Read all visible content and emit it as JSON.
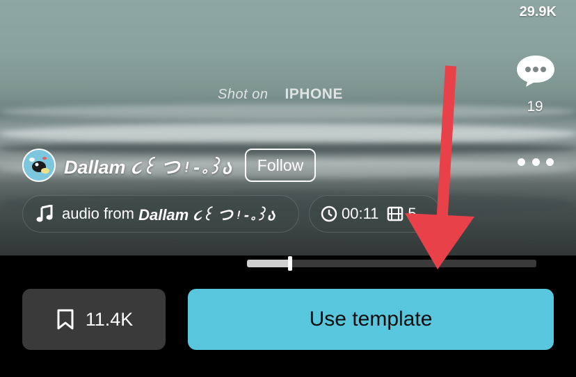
{
  "video": {
    "watermark_prefix": "Shot on",
    "watermark_brand": "IPHONE"
  },
  "sidebar": {
    "likes_count": "29.9K",
    "comments_count": "19",
    "comment_icon": "comment-bubble-icon",
    "more_icon": "more-dots-icon"
  },
  "author": {
    "name": "Dallam ૮꒰ つ ᵎ -｡꒱ა",
    "follow_label": "Follow"
  },
  "audio": {
    "prefix": "audio from",
    "author": "Dallam ૮꒰ つ ᵎ -｡꒱ა",
    "icon": "music-note-icon"
  },
  "meta": {
    "duration": "00:11",
    "clock_icon": "clock-icon",
    "clips_icon": "film-icon",
    "clips_count": "5"
  },
  "playback": {
    "progress": 0.15
  },
  "actions": {
    "save_count": "11.4K",
    "save_icon": "bookmark-icon",
    "use_template_label": "Use template",
    "use_template_color": "#58c7dd"
  },
  "annotation": {
    "arrow_color": "#e8414a"
  }
}
